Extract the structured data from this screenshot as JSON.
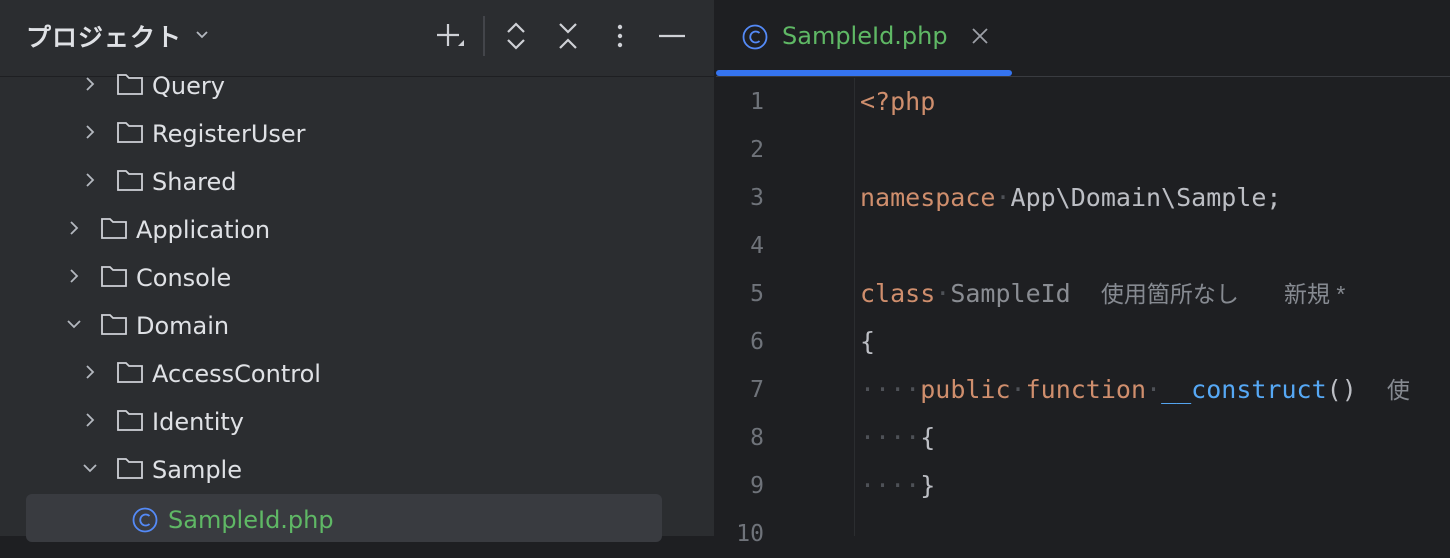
{
  "project": {
    "title": "プロジェクト",
    "toolbar": [
      "new-icon",
      "expand-all-icon",
      "collapse-all-icon",
      "more-icon",
      "minimize-icon"
    ]
  },
  "tree": [
    {
      "label": "Query",
      "type": "folder",
      "expanded": false
    },
    {
      "label": "RegisterUser",
      "type": "folder",
      "expanded": false
    },
    {
      "label": "Shared",
      "type": "folder",
      "expanded": false
    },
    {
      "label": "Application",
      "type": "folder",
      "expanded": false
    },
    {
      "label": "Console",
      "type": "folder",
      "expanded": false
    },
    {
      "label": "Domain",
      "type": "folder",
      "expanded": true
    },
    {
      "label": "AccessControl",
      "type": "folder",
      "expanded": false
    },
    {
      "label": "Identity",
      "type": "folder",
      "expanded": false
    },
    {
      "label": "Sample",
      "type": "folder",
      "expanded": true
    },
    {
      "label": "SampleId.php",
      "type": "class-file",
      "selected": true
    }
  ],
  "editor": {
    "tab": {
      "label": "SampleId.php"
    },
    "line_numbers": [
      "1",
      "2",
      "3",
      "4",
      "5",
      "6",
      "7",
      "8",
      "9",
      "10"
    ],
    "code": {
      "l1": "<?php",
      "l3_kw": "namespace",
      "l3_ns": "App\\Domain\\Sample;",
      "l5_kw": "class",
      "l5_name": "SampleId",
      "l5_hint_usage": "使用箇所なし",
      "l5_hint_new": "新規 *",
      "l6": "{",
      "l7_kw1": "public",
      "l7_kw2": "function",
      "l7_fn": "__construct",
      "l7_paren": "()",
      "l7_hint": "使",
      "l8": "{",
      "l9": "}"
    }
  },
  "colors": {
    "accent": "#3574f0",
    "class_green": "#5fb865",
    "keyword": "#cf8e6d",
    "function": "#56a8f5"
  }
}
